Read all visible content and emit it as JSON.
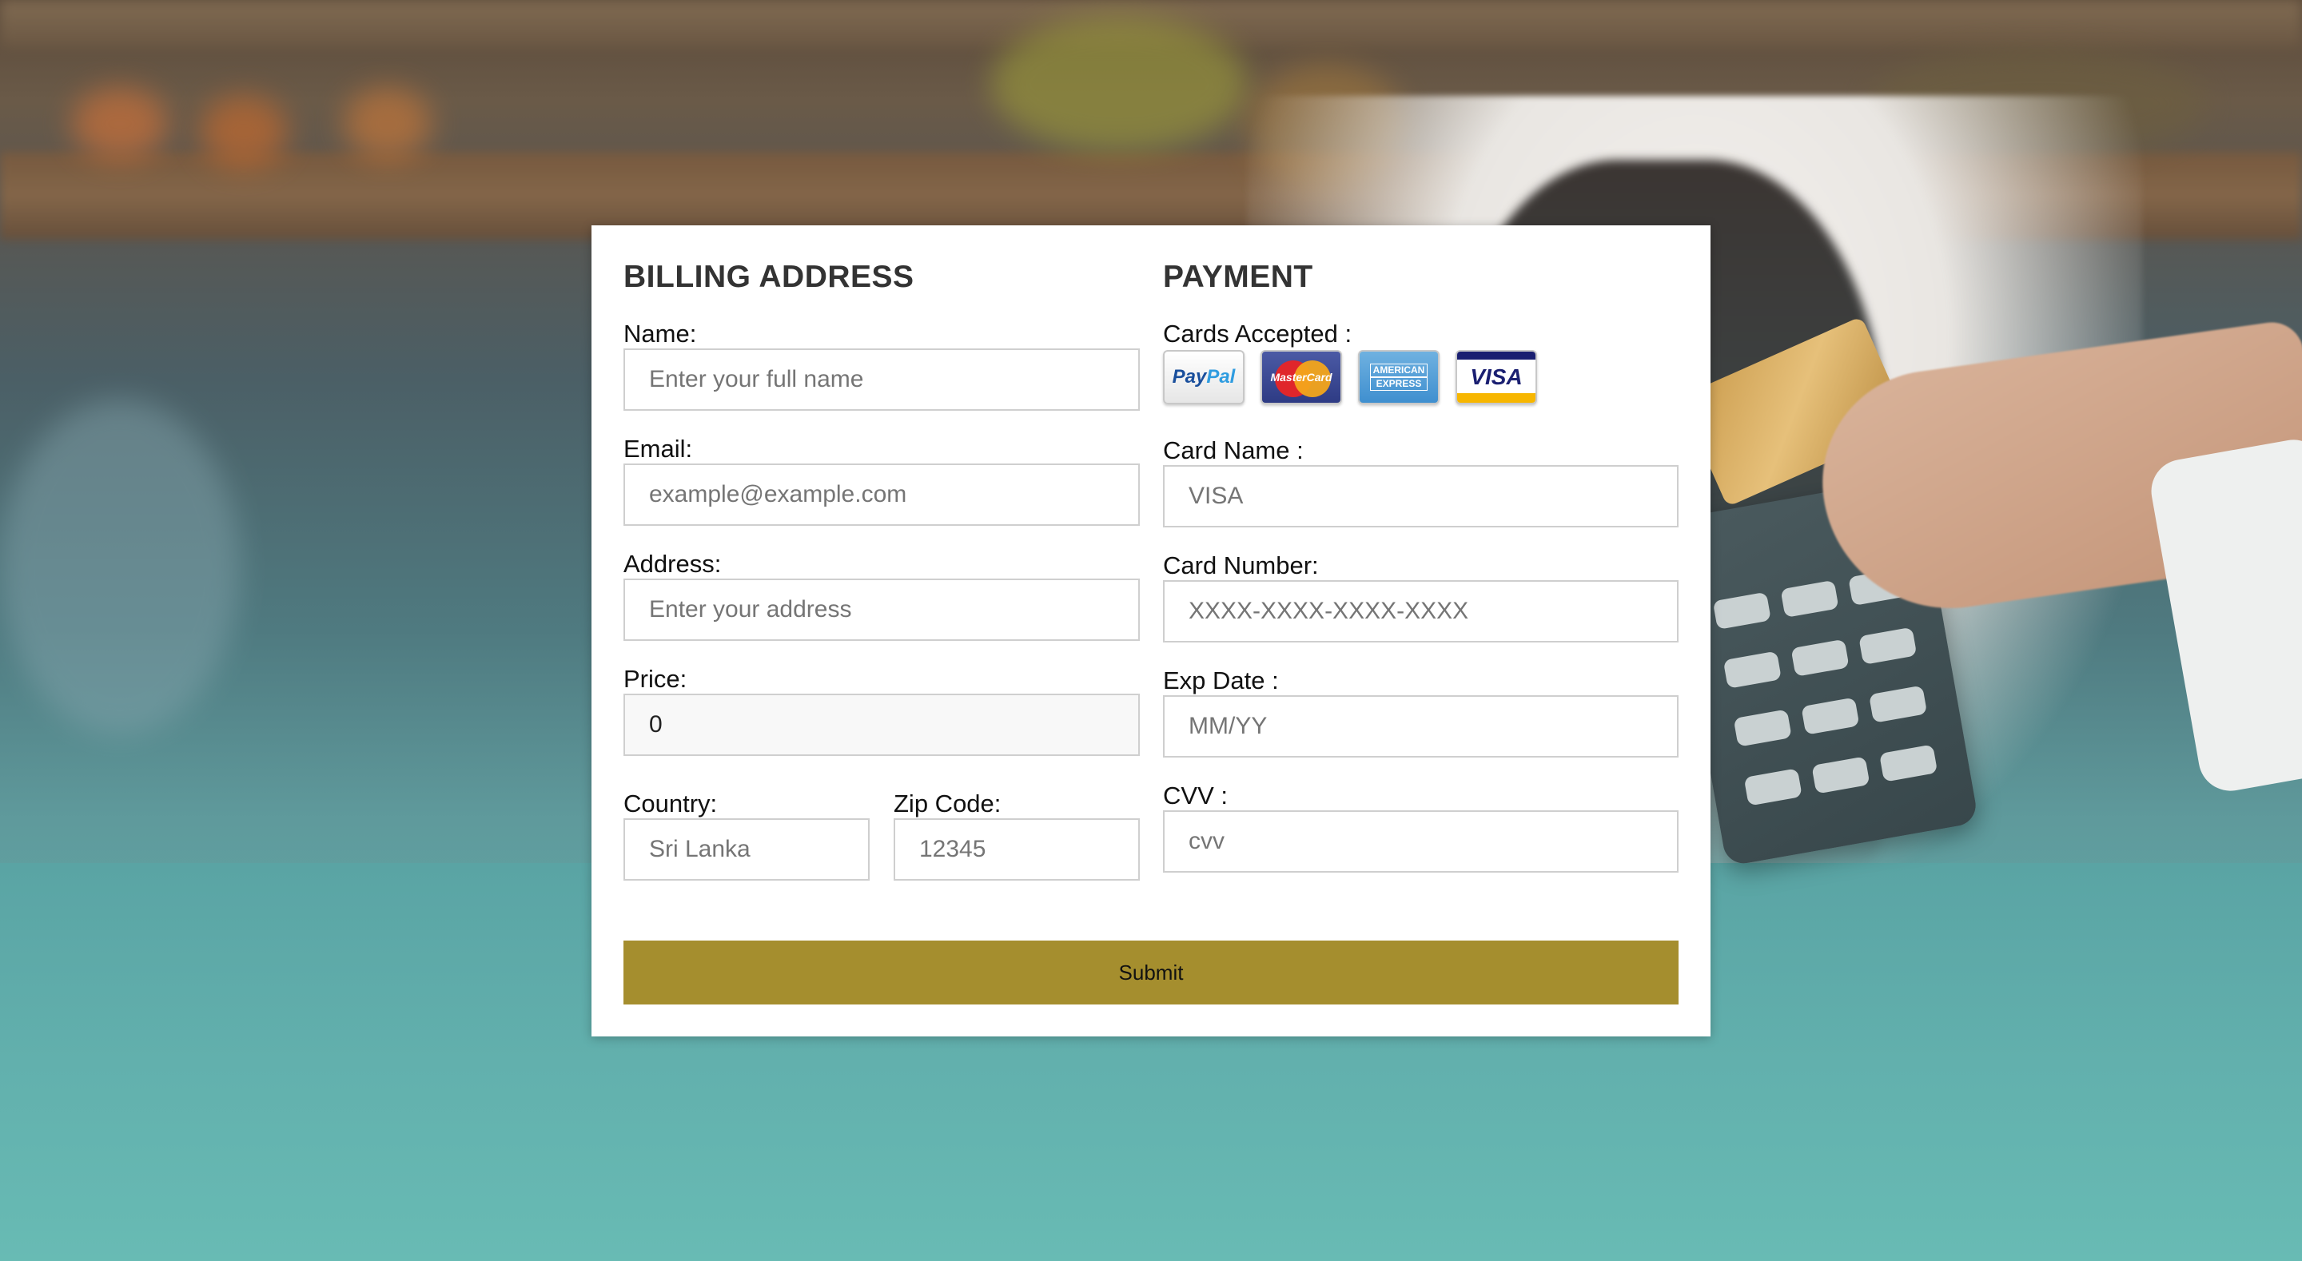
{
  "billing": {
    "title": "BILLING ADDRESS",
    "name_label": "Name:",
    "name_placeholder": "Enter your full name",
    "email_label": "Email:",
    "email_placeholder": "example@example.com",
    "address_label": "Address:",
    "address_placeholder": "Enter your address",
    "price_label": "Price:",
    "price_value": "0",
    "country_label": "Country:",
    "country_placeholder": "Sri Lanka",
    "zip_label": "Zip Code:",
    "zip_placeholder": "12345"
  },
  "payment": {
    "title": "PAYMENT",
    "cards_label": "Cards Accepted :",
    "cards": [
      {
        "name": "paypal-icon",
        "text_a": "Pay",
        "text_b": "Pal"
      },
      {
        "name": "mastercard-icon",
        "text": "MasterCard"
      },
      {
        "name": "amex-icon",
        "text_a": "AMERICAN",
        "text_b": "EXPRESS"
      },
      {
        "name": "visa-icon",
        "text": "VISA"
      }
    ],
    "card_name_label": "Card Name :",
    "card_name_placeholder": "VISA",
    "card_number_label": "Card Number:",
    "card_number_placeholder": "XXXX-XXXX-XXXX-XXXX",
    "exp_label": "Exp Date :",
    "exp_placeholder": "MM/YY",
    "cvv_label": "CVV :",
    "cvv_placeholder": "cvv"
  },
  "submit_label": "Submit",
  "colors": {
    "submit_bg": "#a58e2e",
    "panel_bg": "#ffffff",
    "heading": "#333333"
  }
}
